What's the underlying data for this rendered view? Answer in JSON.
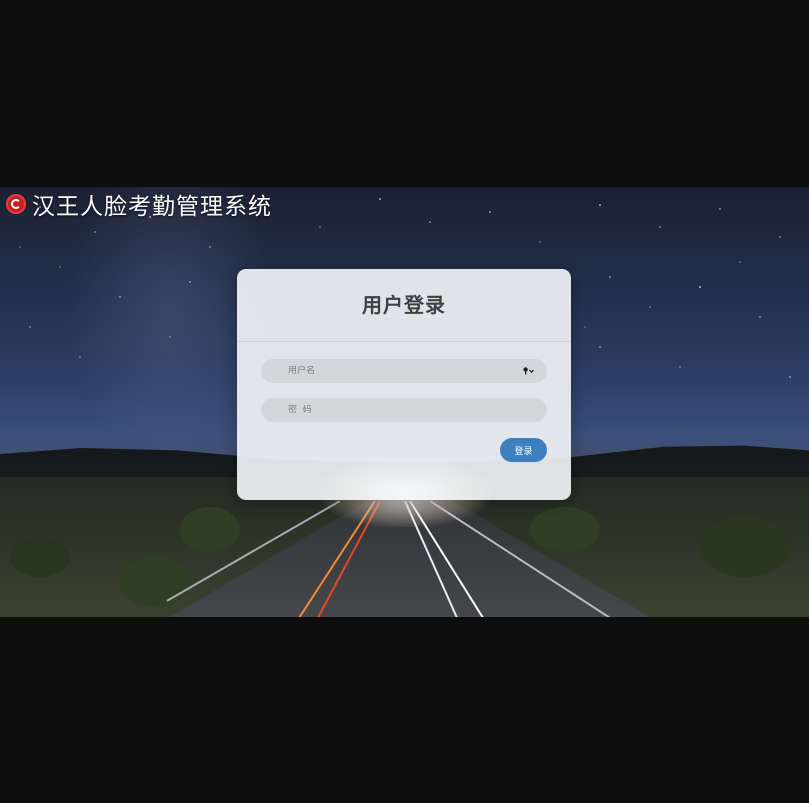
{
  "app": {
    "title": "汉王人脸考勤管理系统",
    "logo_icon": "hanwang-logo-icon"
  },
  "login": {
    "heading": "用户登录",
    "username_placeholder": "用户名",
    "password_placeholder": "密  码",
    "submit_label": "登录",
    "key_icon": "key-dropdown-icon"
  },
  "colors": {
    "accent": "#3e7fbf",
    "logo": "#c71f1f",
    "page_background": "#0e0e0f"
  }
}
